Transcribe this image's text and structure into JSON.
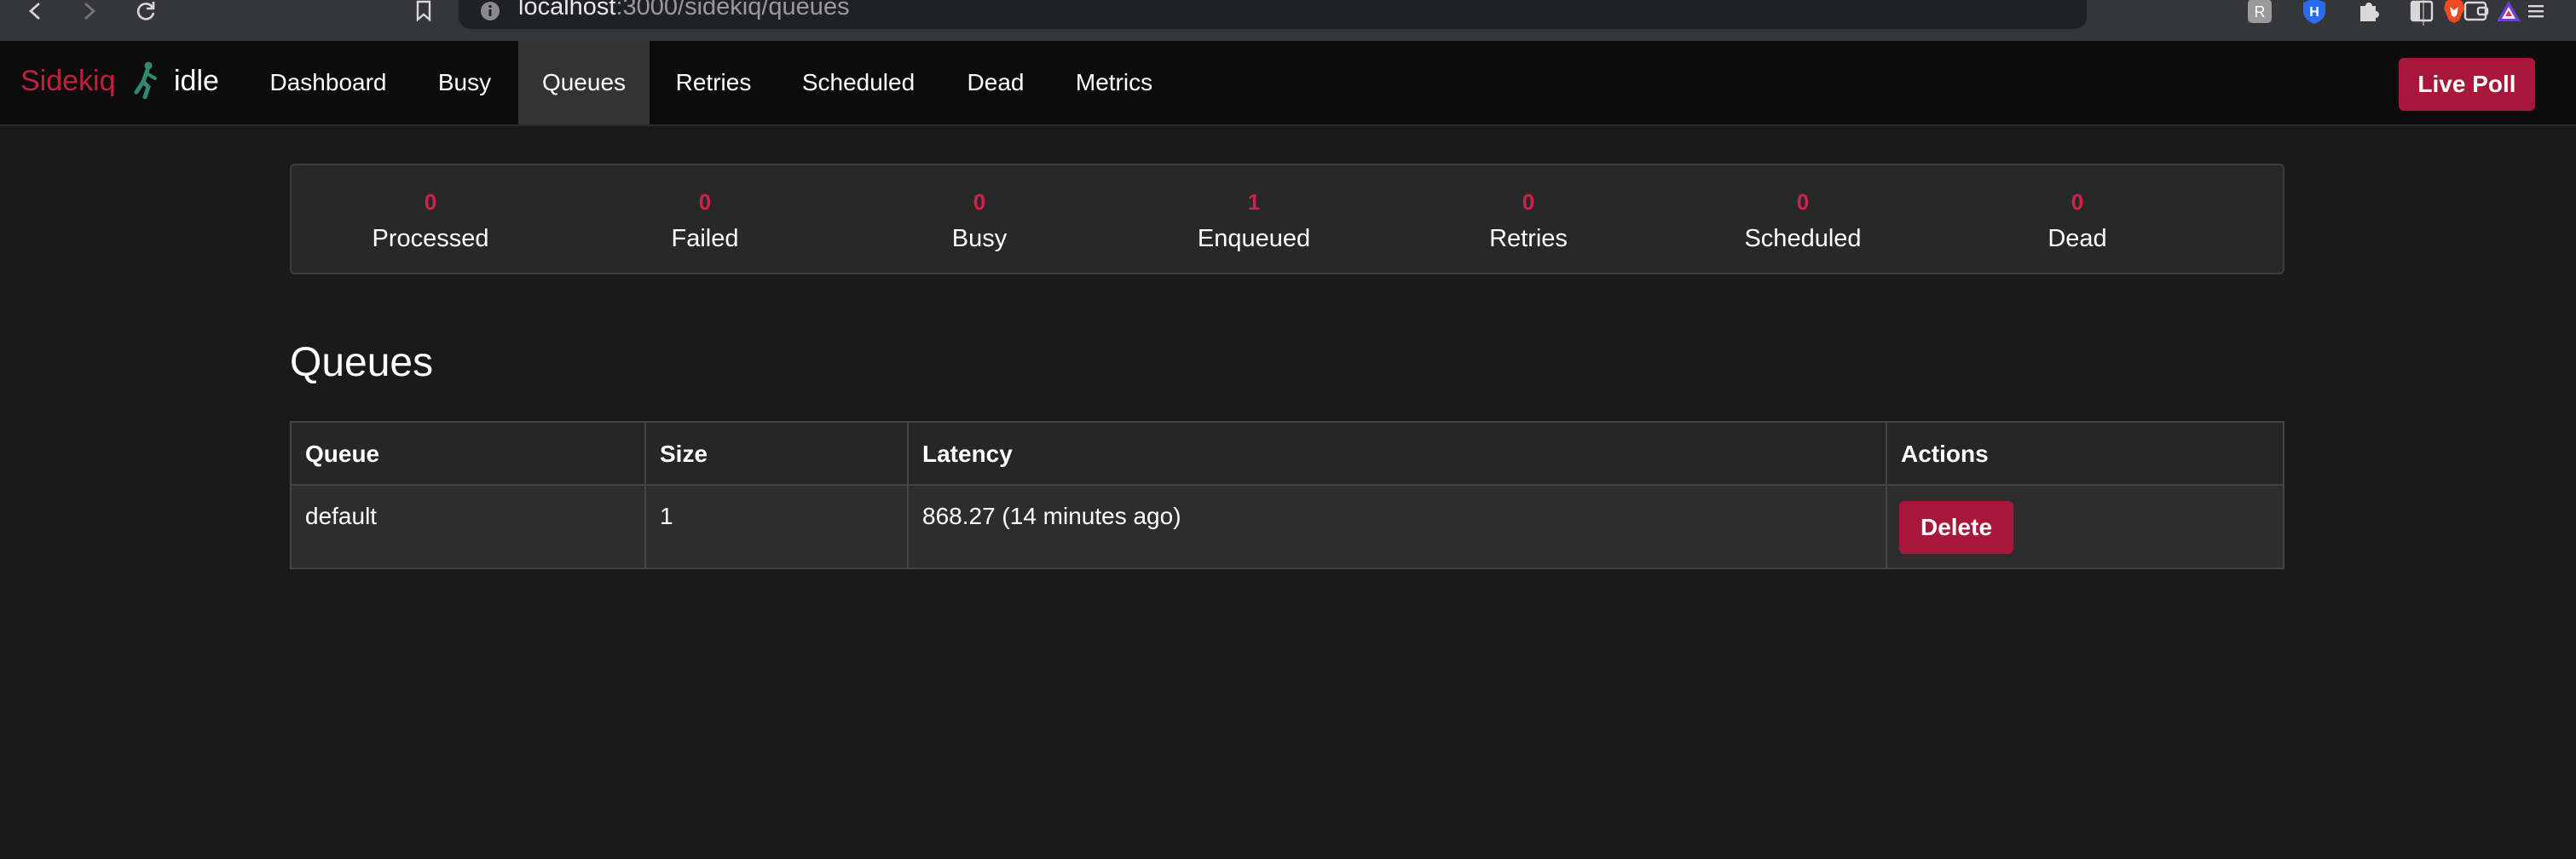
{
  "browser": {
    "url_host": "localhost",
    "url_path": ":3000/sidekiq/queues"
  },
  "brand": {
    "name": "Sidekiq",
    "status": "idle",
    "brand_color": "#c0203f"
  },
  "nav": {
    "items": [
      {
        "label": "Dashboard",
        "active": false
      },
      {
        "label": "Busy",
        "active": false
      },
      {
        "label": "Queues",
        "active": true
      },
      {
        "label": "Retries",
        "active": false
      },
      {
        "label": "Scheduled",
        "active": false
      },
      {
        "label": "Dead",
        "active": false
      },
      {
        "label": "Metrics",
        "active": false
      }
    ],
    "live_poll_label": "Live Poll"
  },
  "summary": {
    "stats": [
      {
        "count": "0",
        "label": "Processed"
      },
      {
        "count": "0",
        "label": "Failed"
      },
      {
        "count": "0",
        "label": "Busy"
      },
      {
        "count": "1",
        "label": "Enqueued"
      },
      {
        "count": "0",
        "label": "Retries"
      },
      {
        "count": "0",
        "label": "Scheduled"
      },
      {
        "count": "0",
        "label": "Dead"
      }
    ]
  },
  "queues": {
    "title": "Queues",
    "columns": [
      "Queue",
      "Size",
      "Latency",
      "Actions"
    ],
    "rows": [
      {
        "queue": "default",
        "size": "1",
        "latency": "868.27 (14 minutes ago)",
        "action_label": "Delete"
      }
    ]
  },
  "colors": {
    "accent": "#a8173a",
    "count": "#d0214a",
    "background": "#1a1a1a"
  }
}
